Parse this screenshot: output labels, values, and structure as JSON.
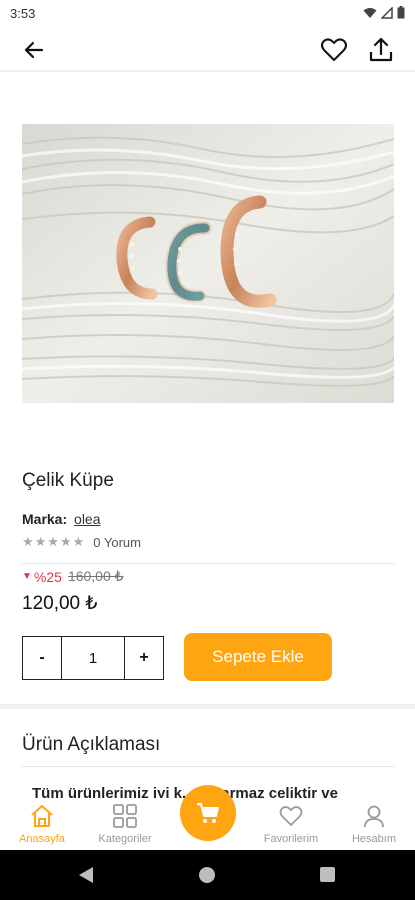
{
  "status_bar": {
    "time": "3:53"
  },
  "app_bar": {
    "back_icon": "arrow-left-icon",
    "favorite_icon": "heart-outline-icon",
    "share_icon": "share-upload-icon"
  },
  "product": {
    "title": "Çelik Küpe",
    "brand_label": "Marka:",
    "brand_value": "olea",
    "rating_stars": "★★★★★",
    "rating_value": 0,
    "reviews": "0 Yorum",
    "discount": "%25",
    "old_price": "160,00 ₺",
    "price": "120,00 ₺"
  },
  "quantity": {
    "minus": "-",
    "value": "1",
    "plus": "+"
  },
  "add_to_cart_label": "Sepete Ekle",
  "description": {
    "title": "Ürün Açıklaması",
    "text": "Tüm ürünlerimiz iyi k... kararmaz çeliktir ve"
  },
  "bottom_nav": {
    "items": [
      {
        "label": "Anasayfa",
        "icon": "home-icon",
        "active": true
      },
      {
        "label": "Kategoriler",
        "icon": "grid-icon",
        "active": false
      },
      {
        "label": "Favorilerim",
        "icon": "heart-outline-icon",
        "active": false
      },
      {
        "label": "Hesabım",
        "icon": "user-icon",
        "active": false
      }
    ],
    "cart_icon": "cart-icon"
  },
  "colors": {
    "accent": "#ffa511",
    "discount": "#e0344b",
    "text": "#222222"
  }
}
